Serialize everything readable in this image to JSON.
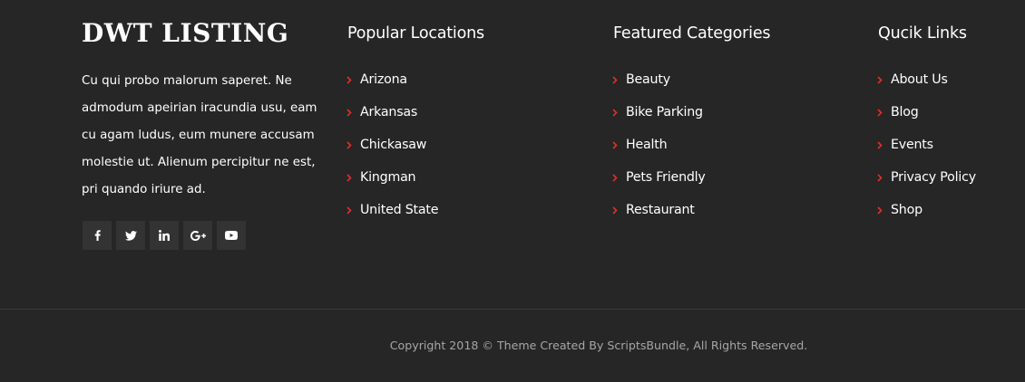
{
  "brand": {
    "title": "DWT LISTING",
    "about": "Cu qui probo malorum saperet. Ne admodum apeirian iracundia usu, eam cu agam ludus, eum munere accusam molestie ut. Alienum percipitur ne est, pri quando iriure ad."
  },
  "social_icons": [
    "facebook-icon",
    "twitter-icon",
    "linkedin-icon",
    "google-plus-icon",
    "youtube-icon"
  ],
  "columns": [
    {
      "heading": "Popular Locations",
      "items": [
        "Arizona",
        "Arkansas",
        "Chickasaw",
        "Kingman",
        "United State"
      ]
    },
    {
      "heading": "Featured Categories",
      "items": [
        "Beauty",
        "Bike Parking",
        "Health",
        "Pets Friendly",
        "Restaurant"
      ]
    },
    {
      "heading": "Qucik Links",
      "items": [
        "About Us",
        "Blog",
        "Events",
        "Privacy Policy",
        "Shop"
      ]
    }
  ],
  "copyright": "Copyright 2018 © Theme Created By ScriptsBundle, All Rights Reserved.",
  "colors": {
    "background": "#262626",
    "accent": "#e52d27",
    "text": "#ffffff",
    "muted": "#a6a6a6",
    "social_bg": "#333333"
  }
}
